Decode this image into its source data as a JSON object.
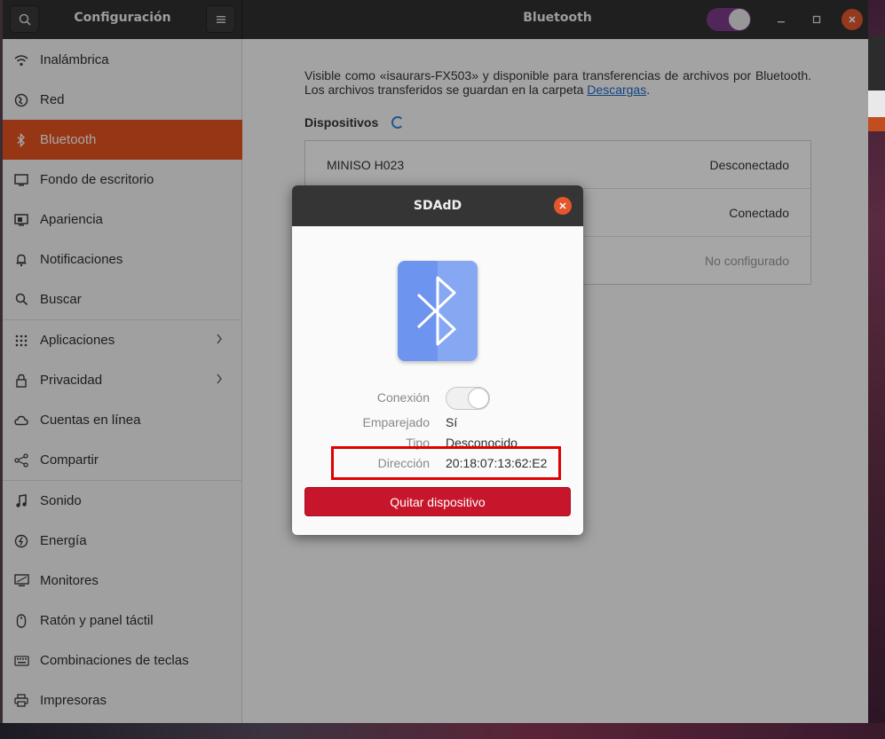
{
  "window": {
    "sidebar_title": "Configuración",
    "panel_title": "Bluetooth",
    "bluetooth_enabled": true
  },
  "sidebar": {
    "items": [
      {
        "label": "Inalámbrica",
        "icon": "wifi-icon"
      },
      {
        "label": "Red",
        "icon": "network-icon"
      },
      {
        "label": "Bluetooth",
        "icon": "bluetooth-icon",
        "active": true
      },
      {
        "label": "Fondo de escritorio",
        "icon": "wallpaper-icon"
      },
      {
        "label": "Apariencia",
        "icon": "appearance-icon"
      },
      {
        "label": "Notificaciones",
        "icon": "bell-icon"
      },
      {
        "label": "Buscar",
        "icon": "search-icon"
      },
      {
        "label": "Aplicaciones",
        "icon": "apps-grid-icon",
        "submenu": true
      },
      {
        "label": "Privacidad",
        "icon": "lock-icon",
        "submenu": true
      },
      {
        "label": "Cuentas en línea",
        "icon": "cloud-icon"
      },
      {
        "label": "Compartir",
        "icon": "share-icon"
      },
      {
        "label": "Sonido",
        "icon": "music-note-icon"
      },
      {
        "label": "Energía",
        "icon": "power-icon"
      },
      {
        "label": "Monitores",
        "icon": "monitor-icon"
      },
      {
        "label": "Ratón y panel táctil",
        "icon": "mouse-icon"
      },
      {
        "label": "Combinaciones de teclas",
        "icon": "keyboard-icon"
      },
      {
        "label": "Impresoras",
        "icon": "printer-icon"
      }
    ]
  },
  "main": {
    "description_prefix": "Visible como «isaurars-FX503» y disponible para transferencias de archivos por Bluetooth. Los archivos transferidos se guardan en la carpeta ",
    "description_link": "Descargas",
    "description_suffix": ".",
    "devices_title": "Dispositivos",
    "devices": [
      {
        "name": "MINISO H023",
        "status": "Desconectado"
      },
      {
        "name": "",
        "status": "Conectado"
      },
      {
        "name": "",
        "status": "No configurado"
      }
    ]
  },
  "dialog": {
    "title": "SDAdD",
    "connection_label": "Conexión",
    "connection_on": false,
    "paired_label": "Emparejado",
    "paired_value": "Sí",
    "type_label": "Tipo",
    "type_value": "Desconocido",
    "address_label": "Dirección",
    "address_value": "20:18:07:13:62:E2",
    "remove_button": "Quitar dispositivo"
  },
  "colors": {
    "accent": "#e95420",
    "remove": "#c7162b",
    "highlight": "#e00000",
    "toggle_on": "#7d3c8c"
  }
}
